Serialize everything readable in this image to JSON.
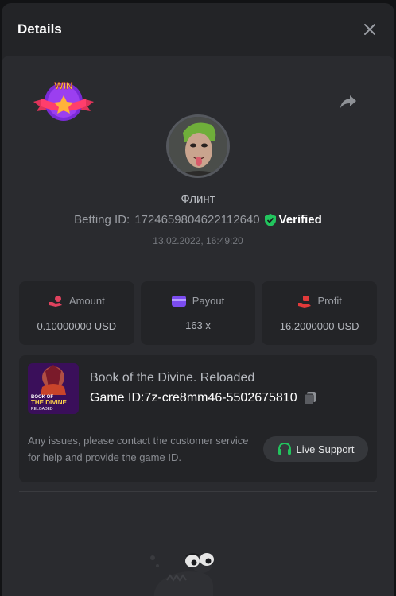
{
  "modal": {
    "title": "Details"
  },
  "player": {
    "name": "Флинт"
  },
  "bet": {
    "betting_id_label": "Betting ID:",
    "betting_id": "1724659804622112640",
    "verified_label": "Verified",
    "datetime": "13.02.2022, 16:49:20"
  },
  "win_badge": {
    "text": "WIN"
  },
  "stats": [
    {
      "label": "Amount",
      "value": "0.10000000 USD",
      "icon": "hand-coin-icon"
    },
    {
      "label": "Payout",
      "value": "163 x",
      "icon": "wallet-card-icon"
    },
    {
      "label": "Profit",
      "value": "16.2000000 USD",
      "icon": "hand-gift-icon"
    }
  ],
  "game": {
    "name": "Book of the Divine. Reloaded",
    "id_label": "Game ID:",
    "id": "7z-cre8mm46-5502675810",
    "thumb_title_1": "BOOK OF",
    "thumb_title_2": "THE DIVINE",
    "thumb_subtitle": "RELOADED"
  },
  "support": {
    "message": "Any issues, please contact the customer service for help and provide the game ID.",
    "button_label": "Live Support"
  },
  "colors": {
    "accent_green": "#22c55e",
    "stat_icon_pink": "#e0425e",
    "stat_icon_purple": "#7b4cf0",
    "stat_icon_red": "#e13a3a"
  }
}
